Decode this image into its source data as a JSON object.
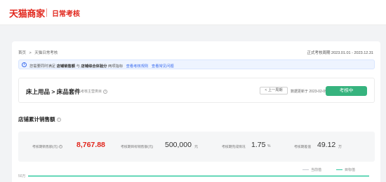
{
  "header": {
    "logo_text": "天猫商家",
    "subtitle": "日常考核"
  },
  "breadcrumb": {
    "home": "首页",
    "sep": ">",
    "current": "天猫日常考核"
  },
  "period": {
    "text": "正式考核周期 2023.01.01 - 2023.12.31"
  },
  "notice": {
    "prefix": "您需要同时满足",
    "bold1": "店铺销售额",
    "mid": "与",
    "bold2": "店铺综合体验分",
    "suffix": "两项指标",
    "link1": "查看考核规则",
    "link2": "查看常见问题"
  },
  "task": {
    "title": "床上用品 > 床品套件",
    "category_note": "考核主营类目",
    "prev_button": "< 上一周期",
    "updated": "数据更新于 2023-02-05",
    "status_button": "考核中"
  },
  "section": {
    "title": "店铺累计销售额"
  },
  "stats": [
    {
      "label": "考核期销售额(元)",
      "value": "8,767.88",
      "unit": ""
    },
    {
      "label": "考核期目标销售额(元)",
      "value": "500,000",
      "unit": "元"
    },
    {
      "label": "考核期完成情况",
      "value": "1.75",
      "unit": "%"
    },
    {
      "label": "考核期差值",
      "value": "49.12",
      "unit": "万"
    }
  ],
  "legend": {
    "current": "当前值",
    "target": "目标值"
  },
  "chart": {
    "y_tick": "50万"
  },
  "colors": {
    "brand_red": "#e1251b",
    "accent_blue": "#3a6cf0",
    "status_green": "#36b37e",
    "target_line": "#2fc9a0",
    "value_red": "#e1251b"
  }
}
